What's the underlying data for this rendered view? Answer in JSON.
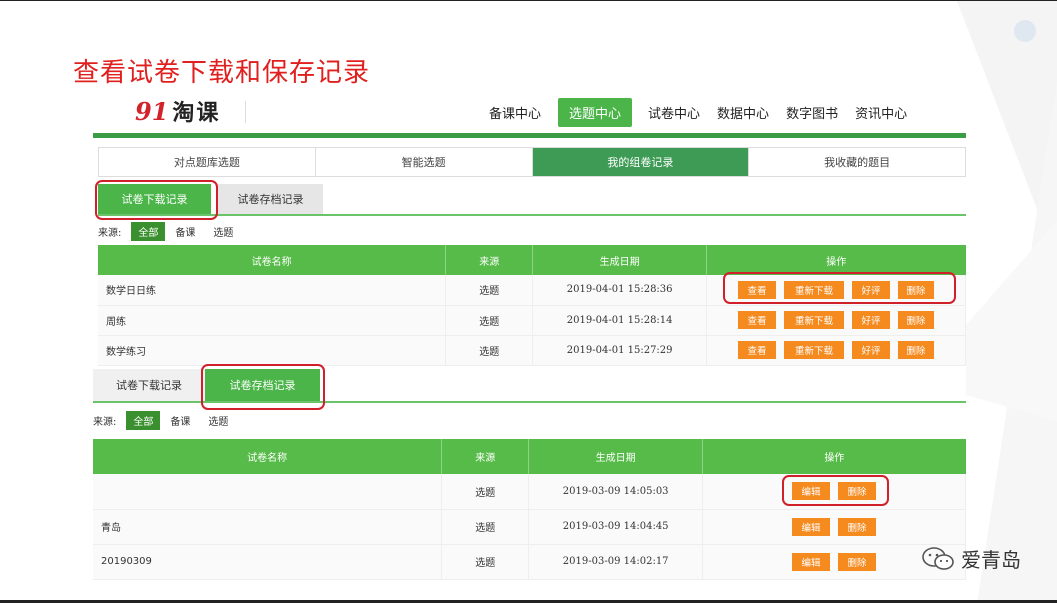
{
  "slide_title": "查看试卷下载和保存记录",
  "logo": {
    "mark": "91",
    "text": "淘课"
  },
  "nav": [
    "备课中心",
    "选题中心",
    "试卷中心",
    "数据中心",
    "数字图书",
    "资讯中心"
  ],
  "nav_active": 1,
  "main_tabs": [
    "对点题库选题",
    "智能选题",
    "我的组卷记录",
    "我收藏的题目"
  ],
  "main_tabs_active": 2,
  "section1": {
    "subtabs": [
      "试卷下载记录",
      "试卷存档记录"
    ],
    "filter_label": "来源:",
    "filter_options": [
      "全部",
      "备课",
      "选题"
    ],
    "columns": [
      "试卷名称",
      "来源",
      "生成日期",
      "操作"
    ],
    "rows": [
      {
        "name": "数学日日练",
        "source": "选题",
        "date": "2019-04-01 15:28:36"
      },
      {
        "name": "周练",
        "source": "选题",
        "date": "2019-04-01 15:28:14"
      },
      {
        "name": "数学练习",
        "source": "选题",
        "date": "2019-04-01 15:27:29"
      }
    ],
    "actions": [
      "查看",
      "重新下载",
      "好评",
      "删除"
    ]
  },
  "section2": {
    "subtabs": [
      "试卷下载记录",
      "试卷存档记录"
    ],
    "filter_label": "来源:",
    "filter_options": [
      "全部",
      "备课",
      "选题"
    ],
    "columns": [
      "试卷名称",
      "来源",
      "生成日期",
      "操作"
    ],
    "rows": [
      {
        "name": "",
        "source": "选题",
        "date": "2019-03-09 14:05:03"
      },
      {
        "name": "青岛",
        "source": "选题",
        "date": "2019-03-09 14:04:45"
      },
      {
        "name": "20190309",
        "source": "选题",
        "date": "2019-03-09 14:02:17"
      }
    ],
    "actions": [
      "编辑",
      "删除"
    ]
  },
  "watermark": "爱青岛",
  "colors": {
    "accent_green": "#4bb54a",
    "dark_green": "#3a9c45",
    "orange": "#f58a1f",
    "red_title": "#e0201f",
    "highlight_red": "#d0202a"
  }
}
